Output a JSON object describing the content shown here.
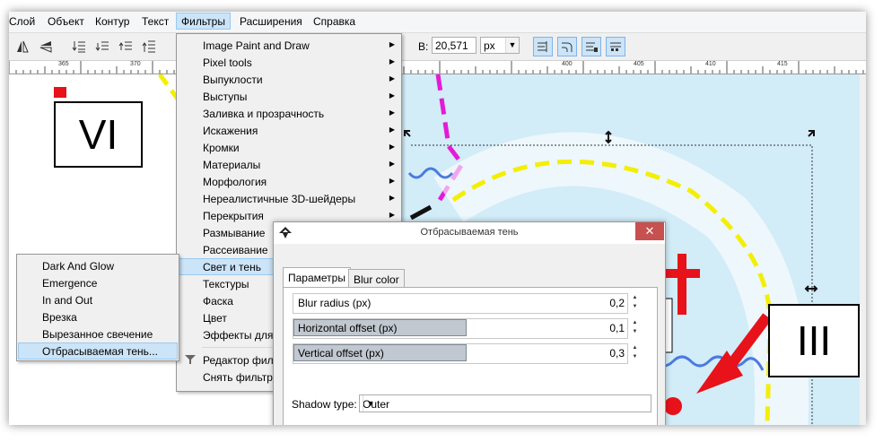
{
  "menubar": {
    "items": [
      "Слой",
      "Объект",
      "Контур",
      "Текст",
      "Фильтры",
      "Расширения",
      "Справка"
    ],
    "active_index": 4
  },
  "toolbar": {
    "h_label": "В:",
    "h_value": "20,571",
    "unit": "px"
  },
  "ruler": {
    "ticks": [
      "365",
      "370",
      "400",
      "405",
      "410",
      "415"
    ]
  },
  "filters_menu": {
    "items": [
      {
        "label": "Image Paint and Draw",
        "submenu": true
      },
      {
        "label": "Pixel tools",
        "submenu": true
      },
      {
        "label": "Выпуклости",
        "submenu": true
      },
      {
        "label": "Выступы",
        "submenu": true
      },
      {
        "label": "Заливка и прозрачность",
        "submenu": true
      },
      {
        "label": "Искажения",
        "submenu": true
      },
      {
        "label": "Кромки",
        "submenu": true
      },
      {
        "label": "Материалы",
        "submenu": true
      },
      {
        "label": "Морфология",
        "submenu": true
      },
      {
        "label": "Нереалистичные 3D-шейдеры",
        "submenu": true
      },
      {
        "label": "Перекрытия",
        "submenu": true
      },
      {
        "label": "Размывание",
        "submenu": true
      },
      {
        "label": "Рассеивание",
        "submenu": true
      },
      {
        "label": "Свет и тень",
        "submenu": true
      },
      {
        "label": "Текстуры",
        "submenu": true
      },
      {
        "label": "Фаска",
        "submenu": true
      },
      {
        "label": "Цвет",
        "submenu": true
      },
      {
        "label": "Эффекты для р",
        "submenu": true
      }
    ],
    "editor_label": "Редактор филь",
    "remove_label": "Снять фильтры"
  },
  "light_shadow_submenu": {
    "items": [
      "Dark And Glow",
      "Emergence",
      "In and Out",
      "Врезка",
      "Вырезанное свечение",
      "Отбрасываемая тень..."
    ]
  },
  "dialog": {
    "title": "Отбрасываемая тень",
    "close": "✕",
    "tabs": [
      "Параметры",
      "Blur color"
    ],
    "fields": [
      {
        "name": "Blur radius (px)",
        "value": "0,2",
        "fill": 0.0
      },
      {
        "name": "Horizontal offset (px)",
        "value": "0,1",
        "fill": 0.52
      },
      {
        "name": "Vertical offset (px)",
        "value": "0,3",
        "fill": 0.52
      }
    ],
    "shadow_type_label": "Shadow type:",
    "shadow_type_value": "Outer"
  },
  "canvas": {
    "box_vi": "VI",
    "box_iii": "III"
  },
  "colors": {
    "menu_highlight": "#cce4f7",
    "canvas_bg": "#d2ecf8",
    "dash_yellow": "#f4ee00",
    "magenta": "#e41bd6",
    "red": "#e8121a",
    "close_btn": "#c75050"
  }
}
